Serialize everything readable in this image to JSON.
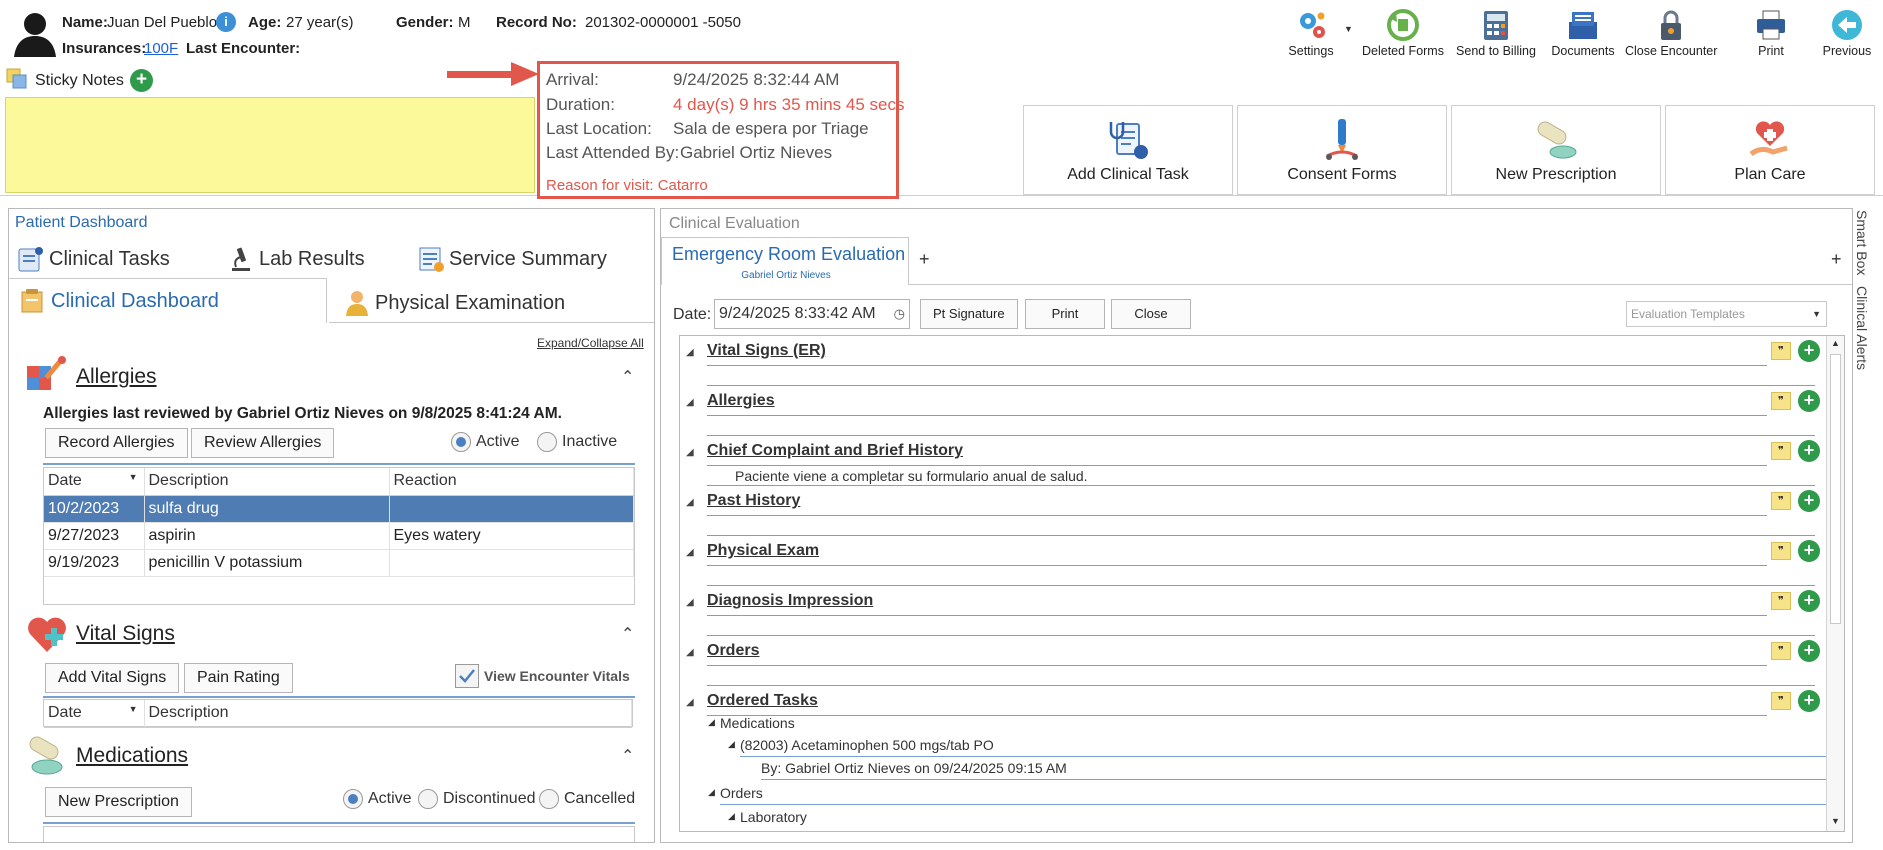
{
  "patient": {
    "name_label": "Name:",
    "name": "Juan Del Pueblo",
    "age_label": "Age:",
    "age": "27 year(s)",
    "gender_label": "Gender:",
    "gender": "M",
    "record_label": "Record No:",
    "record": "201302-0000001 -5050",
    "insurances_label": "Insurances:",
    "insurance": "100F",
    "last_encounter_label": "Last Encounter:"
  },
  "sticky_notes": {
    "label": "Sticky Notes"
  },
  "visit": {
    "arrival_label": "Arrival:",
    "arrival": "9/24/2025 8:32:44 AM",
    "duration_label": "Duration:",
    "duration": "4 day(s) 9 hrs 35 mins 45 secs",
    "location_label": "Last Location:",
    "location": "Sala de espera por Triage",
    "attended_label": "Last Attended By:",
    "attended": "Gabriel Ortiz Nieves",
    "reason": "Reason for visit: Catarro"
  },
  "toolbar": {
    "settings": "Settings",
    "deleted_forms": "Deleted Forms",
    "send_to_billing": "Send to Billing",
    "documents": "Documents",
    "close_encounter": "Close Encounter",
    "print": "Print",
    "previous": "Previous"
  },
  "actions": {
    "add_clinical_task": "Add Clinical Task",
    "consent_forms": "Consent Forms",
    "new_prescription": "New Prescription",
    "plan_care": "Plan Care"
  },
  "dashboard": {
    "title": "Patient Dashboard",
    "tabs": {
      "clinical_tasks": "Clinical Tasks",
      "lab_results": "Lab Results",
      "service_summary": "Service Summary",
      "clinical_dashboard": "Clinical Dashboard",
      "physical_examination": "Physical Examination"
    },
    "expand_collapse": "Expand/Collapse All",
    "allergies": {
      "title": "Allergies",
      "reviewed": "Allergies last reviewed by Gabriel Ortiz Nieves on 9/8/2025 8:41:24 AM.",
      "record_btn": "Record Allergies",
      "review_btn": "Review Allergies",
      "active": "Active",
      "inactive": "Inactive",
      "columns": [
        "Date",
        "Description",
        "Reaction"
      ],
      "rows": [
        {
          "date": "10/2/2023",
          "description": "sulfa drug",
          "reaction": ""
        },
        {
          "date": "9/27/2023",
          "description": "aspirin",
          "reaction": "Eyes watery"
        },
        {
          "date": "9/19/2023",
          "description": "penicillin V potassium",
          "reaction": ""
        }
      ]
    },
    "vitals": {
      "title": "Vital Signs",
      "add_btn": "Add Vital Signs",
      "pain_btn": "Pain Rating",
      "view_encounter": "View Encounter Vitals",
      "columns": [
        "Date",
        "Description"
      ]
    },
    "medications": {
      "title": "Medications",
      "new_btn": "New Prescription",
      "active": "Active",
      "discontinued": "Discontinued",
      "cancelled": "Cancelled"
    }
  },
  "evaluation": {
    "panel_title": "Clinical Evaluation",
    "tab_title": "Emergency Room Evaluation",
    "tab_subtitle": "Gabriel Ortiz Nieves",
    "date_label": "Date:",
    "date_value": "9/24/2025 8:33:42 AM",
    "pt_signature": "Pt Signature",
    "print": "Print",
    "close": "Close",
    "templates_placeholder": "Evaluation Templates",
    "sections": [
      "Vital Signs (ER)",
      "Allergies",
      "Chief Complaint and Brief History",
      "Past History",
      "Physical Exam",
      "Diagnosis Impression",
      "Orders",
      "Ordered Tasks"
    ],
    "chief_complaint_text": "Paciente viene a completar su formulario anual de salud.",
    "tree": {
      "medications": "Medications",
      "med_item": "(82003) Acetaminophen 500 mgs/tab PO",
      "med_by": "By: Gabriel Ortiz Nieves on 09/24/2025 09:15 AM",
      "orders": "Orders",
      "laboratory": "Laboratory"
    }
  },
  "side": {
    "smart_box": "Smart Box",
    "clinical_alerts": "Clinical Alerts"
  },
  "colors": {
    "accent_blue": "#2a6ab0",
    "selected_row": "#4e7cb3",
    "highlight_red": "#e2574c",
    "sticky_yellow": "#fbf99a",
    "add_green": "#2e9a4a"
  }
}
